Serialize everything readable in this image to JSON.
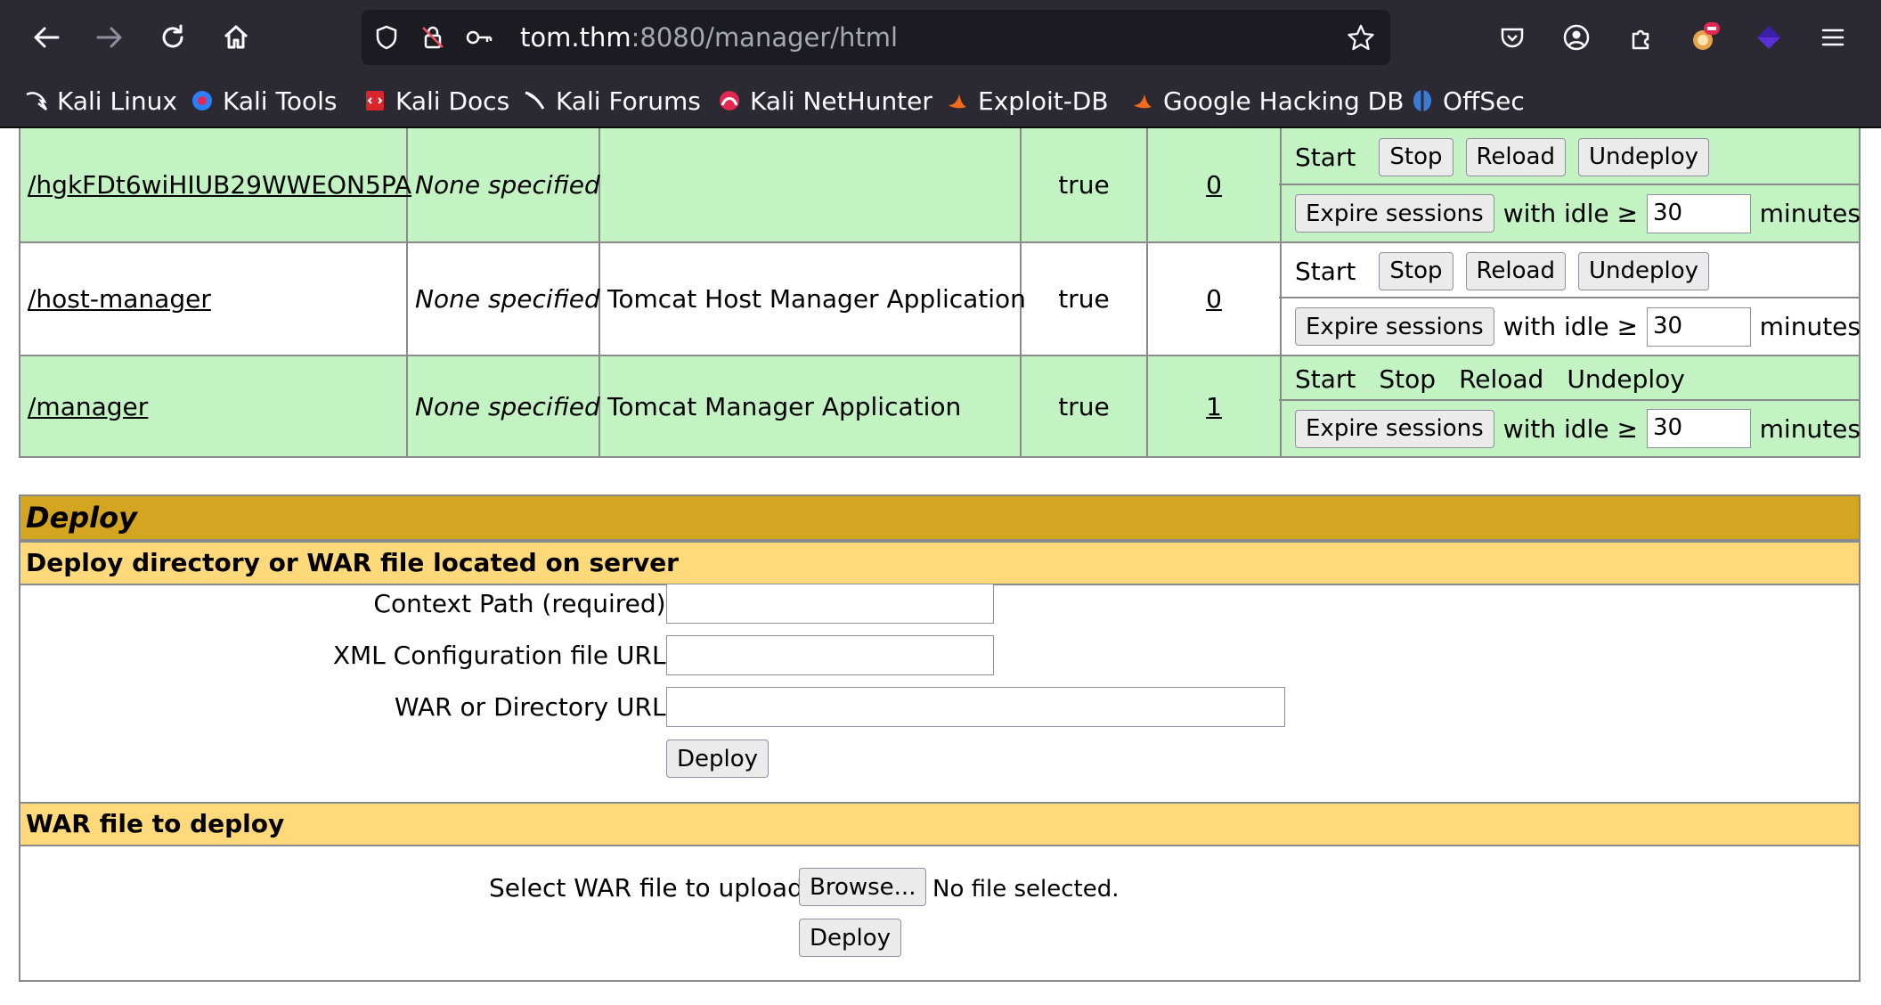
{
  "browser": {
    "url_host": "tom.thm",
    "url_rest": ":8080/manager/html",
    "bookmarks": [
      "Kali Linux",
      "Kali Tools",
      "Kali Docs",
      "Kali Forums",
      "Kali NetHunter",
      "Exploit-DB",
      "Google Hacking DB",
      "OffSec"
    ]
  },
  "apps": [
    {
      "path": "/hgkFDt6wiHIUB29WWEON5PA",
      "version": "None specified",
      "display_name": "",
      "running": "true",
      "sessions": "0"
    },
    {
      "path": "/host-manager",
      "version": "None specified",
      "display_name": "Tomcat Host Manager Application",
      "running": "true",
      "sessions": "0"
    },
    {
      "path": "/manager",
      "version": "None specified",
      "display_name": "Tomcat Manager Application",
      "running": "true",
      "sessions": "1"
    }
  ],
  "commands": {
    "start": "Start",
    "stop": "Stop",
    "reload": "Reload",
    "undeploy": "Undeploy",
    "expire": "Expire sessions",
    "with_idle": "with idle ≥",
    "idle_value": "30",
    "minutes": "minutes"
  },
  "deploy": {
    "title": "Deploy",
    "server_section": "Deploy directory or WAR file located on server",
    "context_path_label": "Context Path (required):",
    "xml_config_label": "XML Configuration file URL:",
    "war_dir_label": "WAR or Directory URL:",
    "deploy_button": "Deploy",
    "war_section": "WAR file to deploy",
    "select_war_label": "Select WAR file to upload",
    "browse_button": "Browse...",
    "no_file": "No file selected."
  }
}
